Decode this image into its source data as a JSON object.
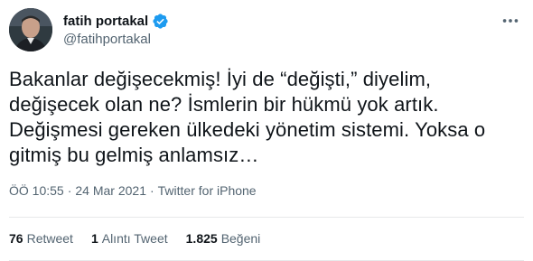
{
  "author": {
    "display_name": "fatih portakal",
    "handle": "@fatihportakal",
    "verified": true
  },
  "icons": {
    "verified": "verified-badge-icon",
    "more": "more-dots-icon"
  },
  "tweet": {
    "text": "Bakanlar değişecekmiş! İyi de “değişti,” diyelim,\ndeğişecek olan ne? İsmlerin bir hükmü yok artık.\nDeğişmesi gereken ülkedeki yönetim sistemi. Yoksa o\ngitmiş bu gelmiş anlamsız…",
    "time": "ÖÖ 10:55",
    "sep1": "·",
    "date": "24 Mar 2021",
    "sep2": "·",
    "source": "Twitter for iPhone"
  },
  "stats": {
    "retweets_count": "76",
    "retweets_label": "Retweet",
    "quotes_count": "1",
    "quotes_label": "Alıntı Tweet",
    "likes_count": "1.825",
    "likes_label": "Beğeni"
  },
  "colors": {
    "accent": "#1d9bf0",
    "text": "#0f1419",
    "muted": "#536471"
  }
}
